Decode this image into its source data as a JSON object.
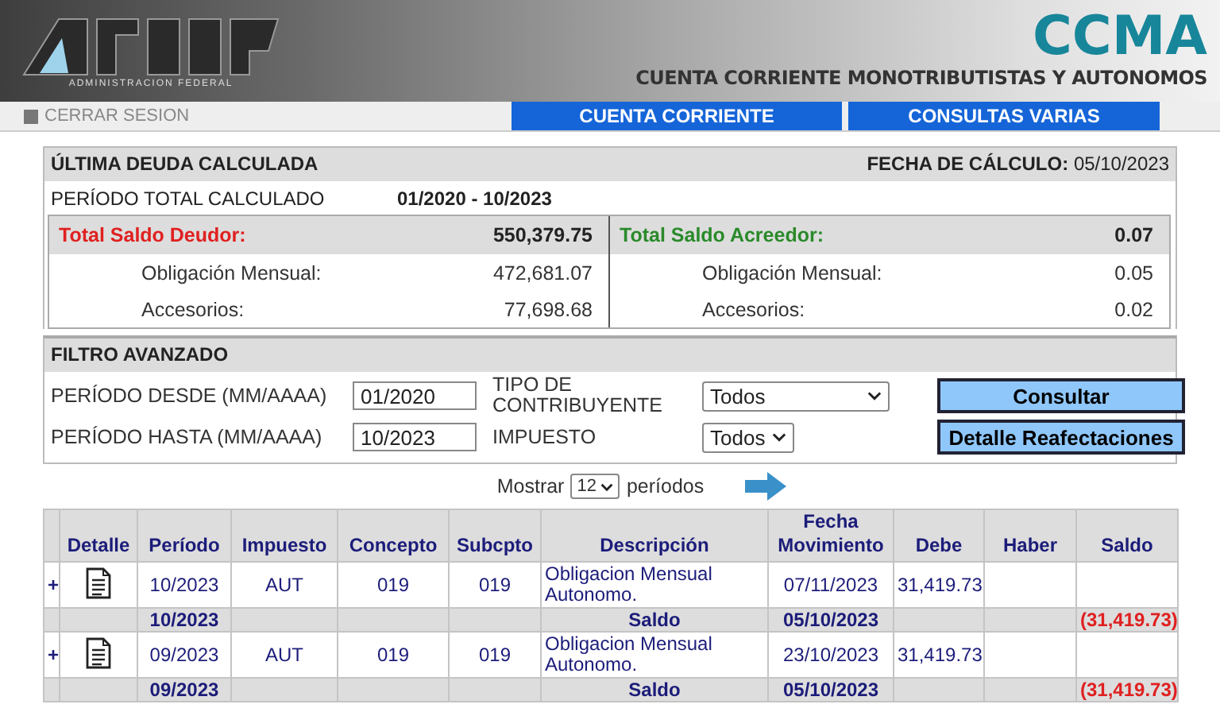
{
  "header": {
    "logo_caption": "ADMINISTRACION FEDERAL",
    "app_name": "CCMA",
    "app_subtitle": "CUENTA CORRIENTE MONOTRIBUTISTAS Y AUTONOMOS"
  },
  "nav": {
    "logout": "CERRAR SESION",
    "tabs": [
      "CUENTA CORRIENTE",
      "CONSULTAS VARIAS"
    ]
  },
  "deuda": {
    "title": "ÚLTIMA DEUDA CALCULADA",
    "date_label": "FECHA DE CÁLCULO:",
    "date_value": "05/10/2023",
    "period_label": "PERÍODO TOTAL CALCULADO",
    "period_value": "01/2020 - 10/2023",
    "panels": [
      {
        "kind": "debit",
        "label": "Total Saldo Deudor:",
        "total": "550,379.75",
        "rows": [
          {
            "label": "Obligación Mensual:",
            "value": "472,681.07"
          },
          {
            "label": "Accesorios:",
            "value": "77,698.68"
          }
        ]
      },
      {
        "kind": "credit",
        "label": "Total Saldo Acreedor:",
        "total": "0.07",
        "rows": [
          {
            "label": "Obligación Mensual:",
            "value": "0.05"
          },
          {
            "label": "Accesorios:",
            "value": "0.02"
          }
        ]
      }
    ]
  },
  "filtro": {
    "title": "FILTRO AVANZADO",
    "fields": [
      {
        "label": "PERÍODO DESDE (MM/AAAA)",
        "value": "01/2020"
      },
      {
        "label": "PERÍODO HASTA (MM/AAAA)",
        "value": "10/2023"
      }
    ],
    "selects": [
      {
        "label": "TIPO DE CONTRIBUYENTE",
        "value": "Todos"
      },
      {
        "label": "IMPUESTO",
        "value": "Todos"
      }
    ],
    "buttons": [
      "Consultar",
      "Detalle Reafectaciones"
    ]
  },
  "paging": {
    "label_before": "Mostrar",
    "value": "12",
    "label_after": "períodos"
  },
  "table": {
    "columns": [
      "Detalle",
      "Período",
      "Impuesto",
      "Concepto",
      "Subcpto",
      "Descripción",
      "Fecha Movimiento",
      "Debe",
      "Haber",
      "Saldo"
    ],
    "rows": [
      {
        "kind": "movement",
        "expander": "+",
        "period": "10/2023",
        "tax": "AUT",
        "concept": "019",
        "subconcept": "019",
        "description": "Obligacion Mensual Autonomo.",
        "date": "07/11/2023",
        "debit": "31,419.73"
      },
      {
        "kind": "balance",
        "period": "10/2023",
        "description": "Saldo",
        "date": "05/10/2023",
        "balance": "(31,419.73)"
      },
      {
        "kind": "movement",
        "expander": "+",
        "period": "09/2023",
        "tax": "AUT",
        "concept": "019",
        "subconcept": "019",
        "description": "Obligacion Mensual Autonomo.",
        "date": "23/10/2023",
        "debit": "31,419.73"
      },
      {
        "kind": "balance",
        "period": "09/2023",
        "description": "Saldo",
        "date": "05/10/2023",
        "balance": "(31,419.73)"
      }
    ]
  }
}
